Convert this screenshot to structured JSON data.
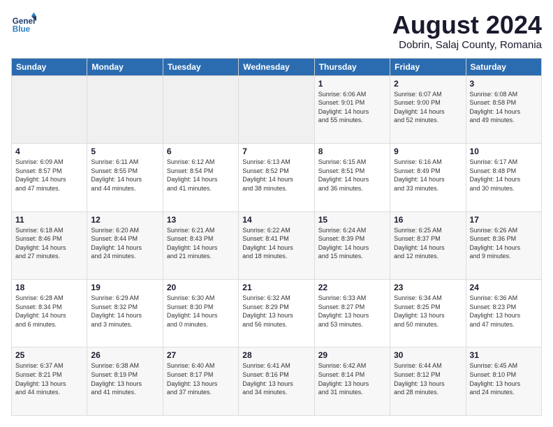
{
  "header": {
    "monthYear": "August 2024",
    "location": "Dobrin, Salaj County, Romania"
  },
  "columns": [
    "Sunday",
    "Monday",
    "Tuesday",
    "Wednesday",
    "Thursday",
    "Friday",
    "Saturday"
  ],
  "weeks": [
    [
      {
        "day": "",
        "info": ""
      },
      {
        "day": "",
        "info": ""
      },
      {
        "day": "",
        "info": ""
      },
      {
        "day": "",
        "info": ""
      },
      {
        "day": "1",
        "info": "Sunrise: 6:06 AM\nSunset: 9:01 PM\nDaylight: 14 hours\nand 55 minutes."
      },
      {
        "day": "2",
        "info": "Sunrise: 6:07 AM\nSunset: 9:00 PM\nDaylight: 14 hours\nand 52 minutes."
      },
      {
        "day": "3",
        "info": "Sunrise: 6:08 AM\nSunset: 8:58 PM\nDaylight: 14 hours\nand 49 minutes."
      }
    ],
    [
      {
        "day": "4",
        "info": "Sunrise: 6:09 AM\nSunset: 8:57 PM\nDaylight: 14 hours\nand 47 minutes."
      },
      {
        "day": "5",
        "info": "Sunrise: 6:11 AM\nSunset: 8:55 PM\nDaylight: 14 hours\nand 44 minutes."
      },
      {
        "day": "6",
        "info": "Sunrise: 6:12 AM\nSunset: 8:54 PM\nDaylight: 14 hours\nand 41 minutes."
      },
      {
        "day": "7",
        "info": "Sunrise: 6:13 AM\nSunset: 8:52 PM\nDaylight: 14 hours\nand 38 minutes."
      },
      {
        "day": "8",
        "info": "Sunrise: 6:15 AM\nSunset: 8:51 PM\nDaylight: 14 hours\nand 36 minutes."
      },
      {
        "day": "9",
        "info": "Sunrise: 6:16 AM\nSunset: 8:49 PM\nDaylight: 14 hours\nand 33 minutes."
      },
      {
        "day": "10",
        "info": "Sunrise: 6:17 AM\nSunset: 8:48 PM\nDaylight: 14 hours\nand 30 minutes."
      }
    ],
    [
      {
        "day": "11",
        "info": "Sunrise: 6:18 AM\nSunset: 8:46 PM\nDaylight: 14 hours\nand 27 minutes."
      },
      {
        "day": "12",
        "info": "Sunrise: 6:20 AM\nSunset: 8:44 PM\nDaylight: 14 hours\nand 24 minutes."
      },
      {
        "day": "13",
        "info": "Sunrise: 6:21 AM\nSunset: 8:43 PM\nDaylight: 14 hours\nand 21 minutes."
      },
      {
        "day": "14",
        "info": "Sunrise: 6:22 AM\nSunset: 8:41 PM\nDaylight: 14 hours\nand 18 minutes."
      },
      {
        "day": "15",
        "info": "Sunrise: 6:24 AM\nSunset: 8:39 PM\nDaylight: 14 hours\nand 15 minutes."
      },
      {
        "day": "16",
        "info": "Sunrise: 6:25 AM\nSunset: 8:37 PM\nDaylight: 14 hours\nand 12 minutes."
      },
      {
        "day": "17",
        "info": "Sunrise: 6:26 AM\nSunset: 8:36 PM\nDaylight: 14 hours\nand 9 minutes."
      }
    ],
    [
      {
        "day": "18",
        "info": "Sunrise: 6:28 AM\nSunset: 8:34 PM\nDaylight: 14 hours\nand 6 minutes."
      },
      {
        "day": "19",
        "info": "Sunrise: 6:29 AM\nSunset: 8:32 PM\nDaylight: 14 hours\nand 3 minutes."
      },
      {
        "day": "20",
        "info": "Sunrise: 6:30 AM\nSunset: 8:30 PM\nDaylight: 14 hours\nand 0 minutes."
      },
      {
        "day": "21",
        "info": "Sunrise: 6:32 AM\nSunset: 8:29 PM\nDaylight: 13 hours\nand 56 minutes."
      },
      {
        "day": "22",
        "info": "Sunrise: 6:33 AM\nSunset: 8:27 PM\nDaylight: 13 hours\nand 53 minutes."
      },
      {
        "day": "23",
        "info": "Sunrise: 6:34 AM\nSunset: 8:25 PM\nDaylight: 13 hours\nand 50 minutes."
      },
      {
        "day": "24",
        "info": "Sunrise: 6:36 AM\nSunset: 8:23 PM\nDaylight: 13 hours\nand 47 minutes."
      }
    ],
    [
      {
        "day": "25",
        "info": "Sunrise: 6:37 AM\nSunset: 8:21 PM\nDaylight: 13 hours\nand 44 minutes."
      },
      {
        "day": "26",
        "info": "Sunrise: 6:38 AM\nSunset: 8:19 PM\nDaylight: 13 hours\nand 41 minutes."
      },
      {
        "day": "27",
        "info": "Sunrise: 6:40 AM\nSunset: 8:17 PM\nDaylight: 13 hours\nand 37 minutes."
      },
      {
        "day": "28",
        "info": "Sunrise: 6:41 AM\nSunset: 8:16 PM\nDaylight: 13 hours\nand 34 minutes."
      },
      {
        "day": "29",
        "info": "Sunrise: 6:42 AM\nSunset: 8:14 PM\nDaylight: 13 hours\nand 31 minutes."
      },
      {
        "day": "30",
        "info": "Sunrise: 6:44 AM\nSunset: 8:12 PM\nDaylight: 13 hours\nand 28 minutes."
      },
      {
        "day": "31",
        "info": "Sunrise: 6:45 AM\nSunset: 8:10 PM\nDaylight: 13 hours\nand 24 minutes."
      }
    ]
  ]
}
